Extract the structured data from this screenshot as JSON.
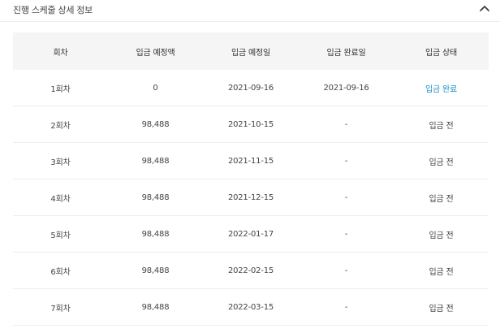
{
  "section": {
    "title": "진행 스케줄 상세 정보",
    "toggle_icon": "chevron-up-icon"
  },
  "colors": {
    "status_done": "#1a8fc4",
    "header_bg": "#f5f5f5",
    "row_border": "#eeeeee"
  },
  "table": {
    "headers": [
      "회차",
      "입금 예정액",
      "입금 예정일",
      "입금 완료일",
      "입금 상태"
    ],
    "rows": [
      {
        "round": "1회차",
        "amount": "0",
        "due_date": "2021-09-16",
        "paid_date": "2021-09-16",
        "status": "입금 완료",
        "status_done": true
      },
      {
        "round": "2회차",
        "amount": "98,488",
        "due_date": "2021-10-15",
        "paid_date": "-",
        "status": "입금 전",
        "status_done": false
      },
      {
        "round": "3회차",
        "amount": "98,488",
        "due_date": "2021-11-15",
        "paid_date": "-",
        "status": "입금 전",
        "status_done": false
      },
      {
        "round": "4회차",
        "amount": "98,488",
        "due_date": "2021-12-15",
        "paid_date": "-",
        "status": "입금 전",
        "status_done": false
      },
      {
        "round": "5회차",
        "amount": "98,488",
        "due_date": "2022-01-17",
        "paid_date": "-",
        "status": "입금 전",
        "status_done": false
      },
      {
        "round": "6회차",
        "amount": "98,488",
        "due_date": "2022-02-15",
        "paid_date": "-",
        "status": "입금 전",
        "status_done": false
      },
      {
        "round": "7회차",
        "amount": "98,488",
        "due_date": "2022-03-15",
        "paid_date": "-",
        "status": "입금 전",
        "status_done": false
      }
    ]
  }
}
